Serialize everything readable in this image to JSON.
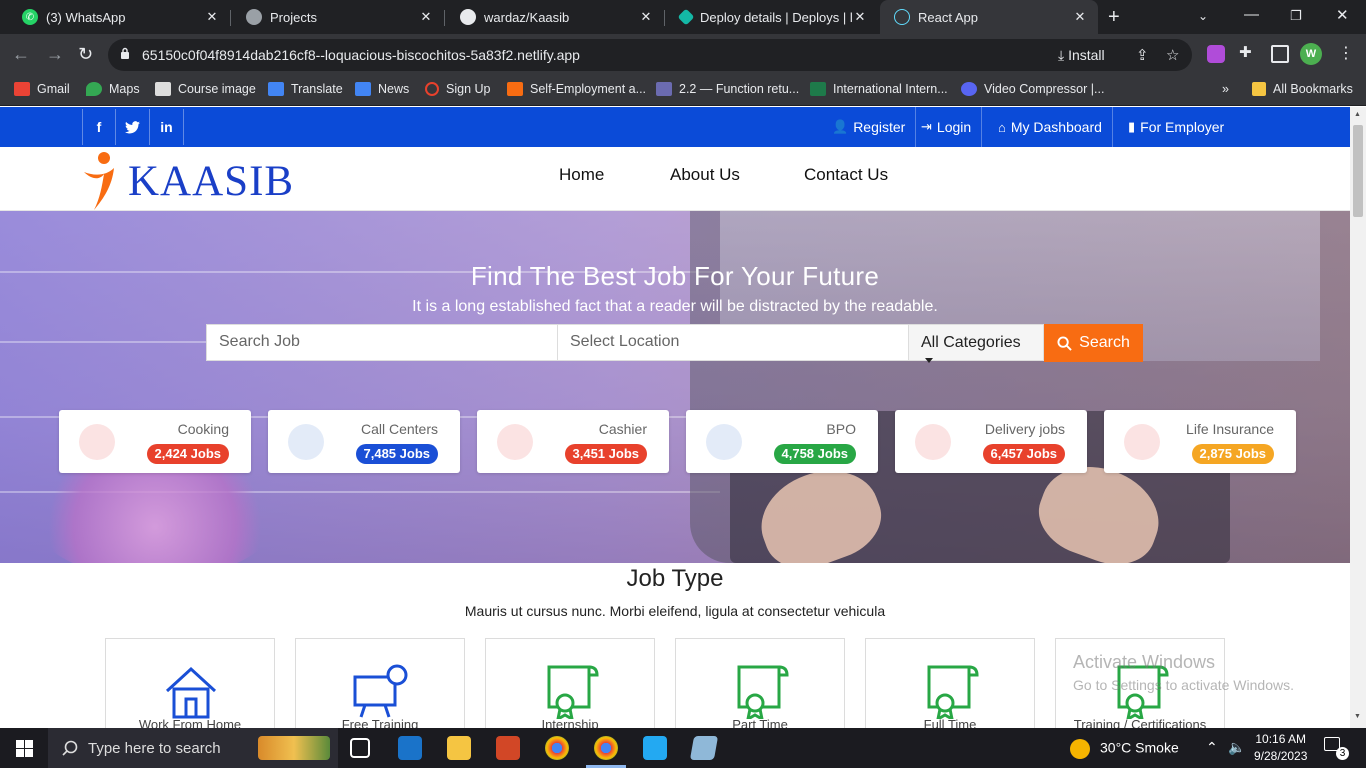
{
  "browser": {
    "tabs": [
      {
        "title": "(3) WhatsApp",
        "active": false
      },
      {
        "title": "Projects",
        "active": false
      },
      {
        "title": "wardaz/Kaasib",
        "active": false
      },
      {
        "title": "Deploy details | Deploys | lo",
        "active": false
      },
      {
        "title": "React App",
        "active": true
      }
    ],
    "url": "65150c0f04f8914dab216cf8--loquacious-biscochitos-5a83f2.netlify.app",
    "install_label": "Install",
    "profile_initial": "W",
    "bookmarks": [
      "Gmail",
      "Maps",
      "Course image",
      "Translate",
      "News",
      "Sign Up",
      "Self-Employment a...",
      "2.2 — Function retu...",
      "International Intern...",
      "Video Compressor |..."
    ],
    "all_bookmarks": "All Bookmarks",
    "overflow": "»"
  },
  "site": {
    "social": [
      "f",
      "t",
      "in"
    ],
    "top_links": [
      {
        "icon": "user-icon",
        "label": "Register"
      },
      {
        "icon": "login-icon",
        "label": "Login"
      },
      {
        "icon": "home-icon",
        "label": "My Dashboard"
      },
      {
        "icon": "building-icon",
        "label": "For Employer"
      }
    ],
    "logo_text": "KAASIB",
    "menu": [
      "Home",
      "About Us",
      "Contact Us"
    ],
    "hero": {
      "title": "Find The Best Job For Your Future",
      "subtitle": "It is a long established fact that a reader will be distracted by the readable.",
      "search_placeholder": "Search Job",
      "location_placeholder": "Select Location",
      "category_select": "All Categories",
      "search_button": "Search"
    },
    "categories": [
      {
        "name": "Cooking",
        "jobs": "2,424 Jobs",
        "color": "#e8412c",
        "icon": "chef-icon"
      },
      {
        "name": "Call Centers",
        "jobs": "7,485 Jobs",
        "color": "#1a4fd6",
        "icon": "headset-icon"
      },
      {
        "name": "Cashier",
        "jobs": "3,451 Jobs",
        "color": "#e8412c",
        "icon": "cashier-icon"
      },
      {
        "name": "BPO",
        "jobs": "4,758 Jobs",
        "color": "#28a745",
        "icon": "headset-icon"
      },
      {
        "name": "Delivery jobs",
        "jobs": "6,457 Jobs",
        "color": "#e8412c",
        "icon": "truck-icon"
      },
      {
        "name": "Life Insurance",
        "jobs": "2,875 Jobs",
        "color": "#f5a623",
        "icon": "insurance-icon"
      }
    ],
    "job_type": {
      "title": "Job Type",
      "subtitle": "Mauris ut cursus nunc. Morbi eleifend, ligula at consectetur vehicula",
      "items": [
        {
          "label": "Work From Home",
          "icon": "house-icon",
          "color": "#1a4fd6"
        },
        {
          "label": "Free Training",
          "icon": "training-board-icon",
          "color": "#1a4fd6"
        },
        {
          "label": "Internship",
          "icon": "certificate-icon",
          "color": "#28a745"
        },
        {
          "label": "Part Time",
          "icon": "certificate-icon",
          "color": "#28a745"
        },
        {
          "label": "Full Time",
          "icon": "certificate-icon",
          "color": "#28a745"
        },
        {
          "label": "Training / Certifications",
          "icon": "certificate-icon",
          "color": "#28a745"
        }
      ]
    }
  },
  "watermark": {
    "line1": "Activate Windows",
    "line2": "Go to Settings to activate Windows."
  },
  "taskbar": {
    "search_placeholder": "Type here to search",
    "weather": "30°C  Smoke",
    "time": "10:16 AM",
    "date": "9/28/2023",
    "notifications": "3"
  }
}
